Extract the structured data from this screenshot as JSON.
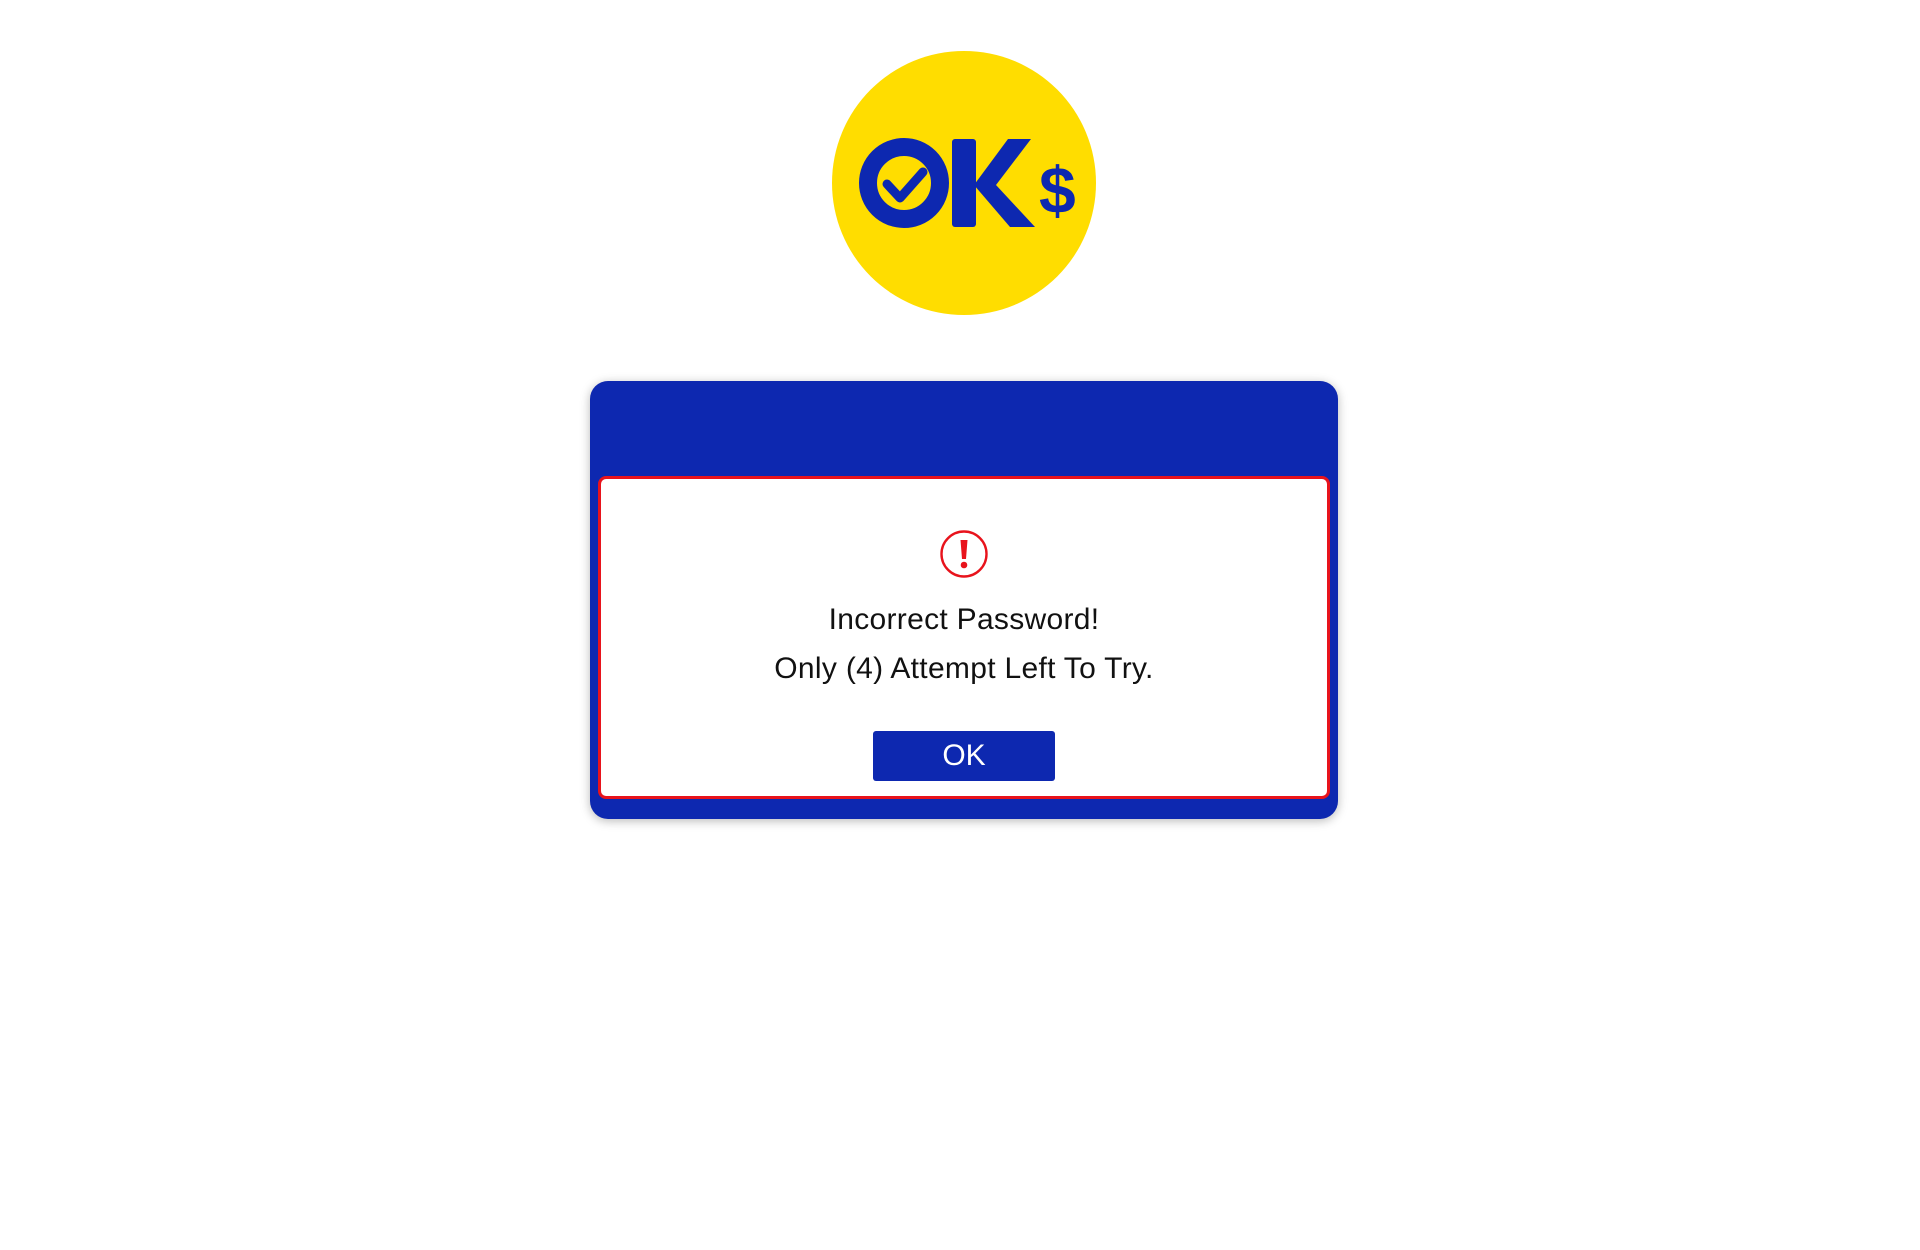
{
  "logo": {
    "text": "OK",
    "symbol": "$",
    "icon": "ok-dollar-logo"
  },
  "dialog": {
    "header_title": "",
    "icon": "alert-exclamation-icon",
    "message_line1": "Incorrect Password!",
    "message_line2": "Only (4) Attempt Left To Try.",
    "ok_label": "OK"
  },
  "colors": {
    "brand_blue": "#0d28b0",
    "logo_yellow": "#ffdd00",
    "alert_red": "#e8131c",
    "text": "#111111"
  }
}
